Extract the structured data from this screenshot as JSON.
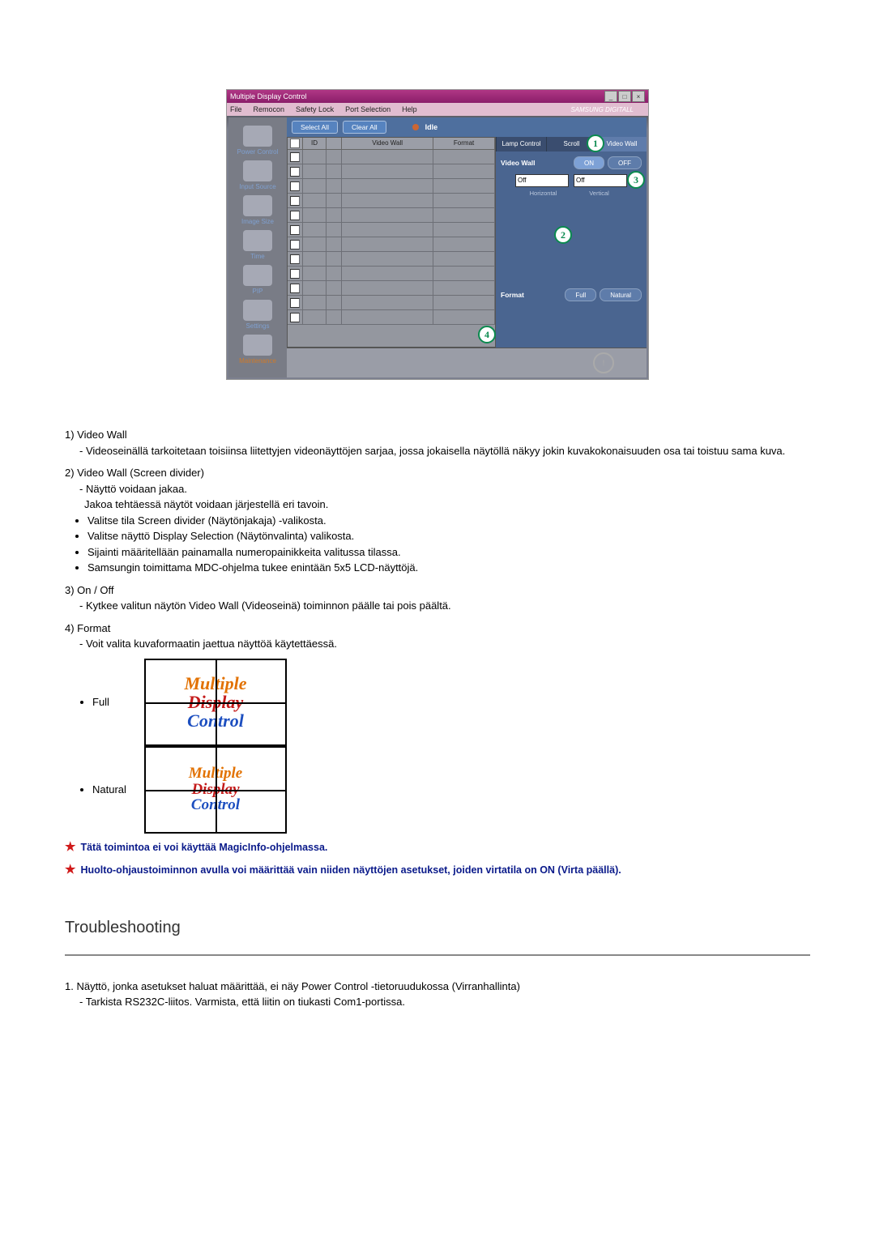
{
  "app": {
    "title": "Multiple Display Control",
    "menus": [
      "File",
      "Remocon",
      "Safety Lock",
      "Port Selection",
      "Help"
    ],
    "brand": "SAMSUNG DIGITALL"
  },
  "sidebar": {
    "items": [
      {
        "label": "Power Control"
      },
      {
        "label": "Input Source"
      },
      {
        "label": "Image Size"
      },
      {
        "label": "Time"
      },
      {
        "label": "PIP"
      },
      {
        "label": "Settings"
      },
      {
        "label": "Maintenance"
      }
    ]
  },
  "toolbar": {
    "select_all": "Select All",
    "clear_all": "Clear All",
    "idle": "Idle"
  },
  "grid": {
    "headers": {
      "id": "ID",
      "video_wall": "Video Wall",
      "format": "Format"
    },
    "row_count": 12
  },
  "rightpanel": {
    "tabs": [
      "Lamp Control",
      "Scroll",
      "Video Wall"
    ],
    "active_tab": 2,
    "vw_label": "Video Wall",
    "on": "ON",
    "off": "OFF",
    "horiz_label": "Horizontal",
    "vert_label": "Vertical",
    "horiz_val": "Off",
    "vert_val": "Off",
    "format_label": "Format",
    "format_full": "Full",
    "format_natural": "Natural"
  },
  "annotations": {
    "a1": "1",
    "a2": "2",
    "a3": "3",
    "a4": "4"
  },
  "doc": {
    "s1_title": "1)  Video Wall",
    "s1_line": "- Videoseinällä tarkoitetaan toisiinsa liitettyjen videonäyttöjen sarjaa, jossa jokaisella näytöllä näkyy jokin kuvakokonaisuuden osa tai toistuu sama kuva.",
    "s2_title": "2)  Video Wall (Screen divider)",
    "s2_l1": "- Näyttö voidaan jakaa.",
    "s2_l2": "Jakoa tehtäessä näytöt voidaan järjestellä eri tavoin.",
    "s2_b1": "Valitse tila Screen divider (Näytönjakaja) -valikosta.",
    "s2_b2": "Valitse näyttö Display Selection (Näytönvalinta) valikosta.",
    "s2_b3": "Sijainti määritellään painamalla numeropainikkeita valitussa tilassa.",
    "s2_b4": "Samsungin toimittama MDC-ohjelma tukee enintään 5x5 LCD-näyttöjä.",
    "s3_title": "3)  On / Off",
    "s3_l1": "- Kytkee valitun näytön Video Wall (Videoseinä) toiminnon päälle tai pois päältä.",
    "s4_title": "4)  Format",
    "s4_l1": "- Voit valita kuvaformaatin jaettua näyttöä käytettäessä.",
    "fmt_full": "Full",
    "fmt_natural": "Natural",
    "mdc_l1": "Multiple",
    "mdc_l2": "Display",
    "mdc_l3": "Control",
    "note1": "Tätä toimintoa ei voi käyttää MagicInfo-ohjelmassa.",
    "note2": "Huolto-ohjaustoiminnon avulla voi määrittää vain niiden näyttöjen asetukset, joiden virtatila on ON (Virta päällä).",
    "trouble_heading": "Troubleshooting",
    "t1": "1. Näyttö, jonka asetukset haluat määrittää, ei näy Power Control -tietoruudukossa (Virranhallinta)",
    "t1_l1": "- Tarkista RS232C-liitos. Varmista, että liitin on tiukasti Com1-portissa."
  }
}
